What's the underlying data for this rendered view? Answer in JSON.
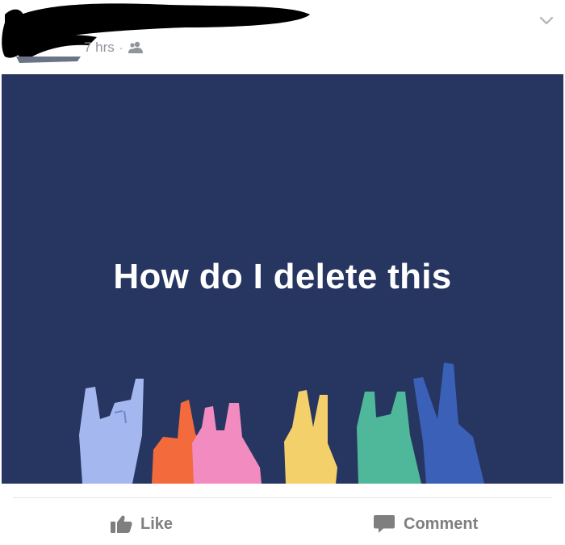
{
  "header": {
    "time": "7 hrs",
    "separator": "·",
    "privacy_icon": "friends-icon",
    "menu_icon": "chevron-down-icon"
  },
  "status": {
    "text": "How do I delete this",
    "background": "#263661",
    "text_color": "#ffffff"
  },
  "actions": {
    "like_label": "Like",
    "comment_label": "Comment"
  },
  "colors": {
    "muted": "#90949c",
    "action": "#7f7f7f"
  }
}
